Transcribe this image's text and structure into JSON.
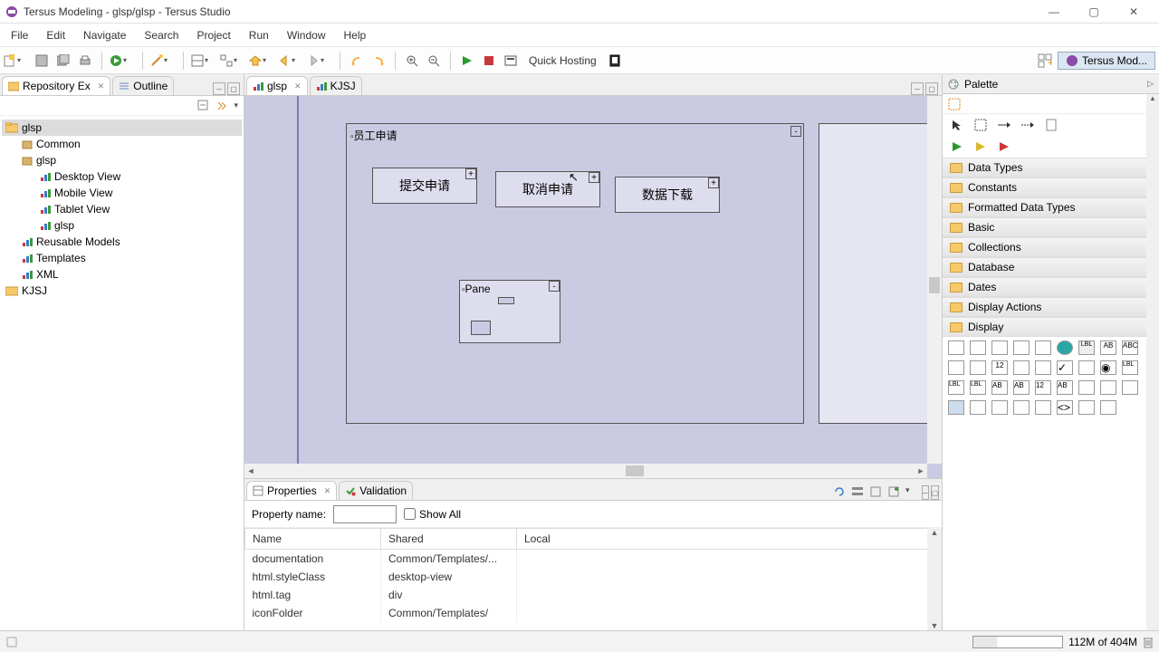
{
  "title": "Tersus Modeling - glsp/glsp - Tersus Studio",
  "menu": [
    "File",
    "Edit",
    "Navigate",
    "Search",
    "Project",
    "Run",
    "Window",
    "Help"
  ],
  "quick_hosting": "Quick Hosting",
  "perspective_label": "Tersus Mod...",
  "repo_tab": "Repository Ex",
  "outline_tab": "Outline",
  "editor_tabs": [
    {
      "label": "glsp",
      "active": true
    },
    {
      "label": "KJSJ",
      "active": false
    }
  ],
  "tree": {
    "root": "glsp",
    "children": [
      {
        "label": "Common",
        "icon": "pkg"
      },
      {
        "label": "glsp",
        "icon": "pkg",
        "children": [
          {
            "label": "Desktop View",
            "icon": "model"
          },
          {
            "label": "Mobile View",
            "icon": "model"
          },
          {
            "label": "Tablet View",
            "icon": "model"
          },
          {
            "label": "glsp",
            "icon": "model"
          }
        ]
      },
      {
        "label": "Reusable Models",
        "icon": "model"
      },
      {
        "label": "Templates",
        "icon": "model"
      },
      {
        "label": "XML",
        "icon": "model"
      }
    ],
    "sibling": "KJSJ"
  },
  "canvas": {
    "big_title": "员工申请",
    "b1": "提交申请",
    "b2": "取消申请",
    "b3": "数据下载",
    "pane": "Pane"
  },
  "palette": {
    "title": "Palette",
    "cats": [
      "Data Types",
      "Constants",
      "Formatted Data Types",
      "Basic",
      "Collections",
      "Database",
      "Dates",
      "Display Actions",
      "Display"
    ]
  },
  "properties": {
    "tab": "Properties",
    "validation_tab": "Validation",
    "filter_label": "Property name:",
    "show_all": "Show All",
    "cols": [
      "Name",
      "Shared",
      "Local"
    ],
    "rows": [
      {
        "n": "documentation",
        "s": "Common/Templates/...",
        "l": ""
      },
      {
        "n": "html.styleClass",
        "s": "desktop-view",
        "l": ""
      },
      {
        "n": "html.tag",
        "s": "div",
        "l": ""
      },
      {
        "n": "iconFolder",
        "s": "Common/Templates/",
        "l": ""
      }
    ]
  },
  "status_mem": "112M of 404M"
}
